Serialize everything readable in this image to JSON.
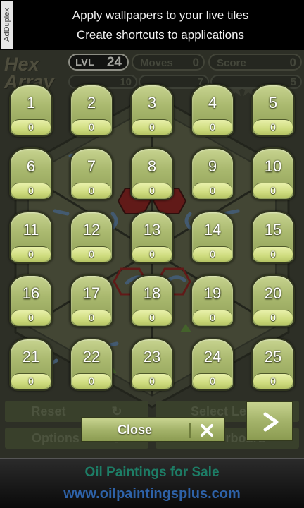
{
  "top_ad": {
    "label": "AdDuplex",
    "line1": "Apply wallpapers to your live tiles",
    "line2": "Create shortcuts to applications"
  },
  "header": {
    "logo_line1": "Hex",
    "logo_line2": "Array",
    "level_label": "LVL",
    "level_value": "24",
    "moves_label": "Moves",
    "moves_value": "0",
    "score_label": "Score",
    "score_value": "0",
    "star_counts": [
      "10",
      "7",
      "5"
    ]
  },
  "game_buttons": {
    "reset": "Reset",
    "select_level": "Select Level",
    "options": "Options",
    "leaderboard": "Leaderboard"
  },
  "level_tiles": [
    {
      "level": "1",
      "score": "0"
    },
    {
      "level": "2",
      "score": "0"
    },
    {
      "level": "3",
      "score": "0"
    },
    {
      "level": "4",
      "score": "0"
    },
    {
      "level": "5",
      "score": "0"
    },
    {
      "level": "6",
      "score": "0"
    },
    {
      "level": "7",
      "score": "0"
    },
    {
      "level": "8",
      "score": "0"
    },
    {
      "level": "9",
      "score": "0"
    },
    {
      "level": "10",
      "score": "0"
    },
    {
      "level": "11",
      "score": "0"
    },
    {
      "level": "12",
      "score": "0"
    },
    {
      "level": "13",
      "score": "0"
    },
    {
      "level": "14",
      "score": "0"
    },
    {
      "level": "15",
      "score": "0"
    },
    {
      "level": "16",
      "score": "0"
    },
    {
      "level": "17",
      "score": "0"
    },
    {
      "level": "18",
      "score": "0"
    },
    {
      "level": "19",
      "score": "0"
    },
    {
      "level": "20",
      "score": "0"
    },
    {
      "level": "21",
      "score": "0"
    },
    {
      "level": "22",
      "score": "0"
    },
    {
      "level": "23",
      "score": "0"
    },
    {
      "level": "24",
      "score": "0"
    },
    {
      "level": "25",
      "score": "0"
    }
  ],
  "dialog": {
    "close_label": "Close",
    "close_icon": "close-x-icon",
    "next_icon": "arrow-right-icon"
  },
  "bottom_ad": {
    "title": "Oil Paintings for Sale",
    "url": "www.oilpaintingsplus.com"
  },
  "colors": {
    "tile_green": "#aab96f",
    "tile_score_band": "#cfdc7f",
    "board_bg": "#3b3d32",
    "ad_title": "#1d7d66",
    "ad_url": "#2e62a8"
  }
}
